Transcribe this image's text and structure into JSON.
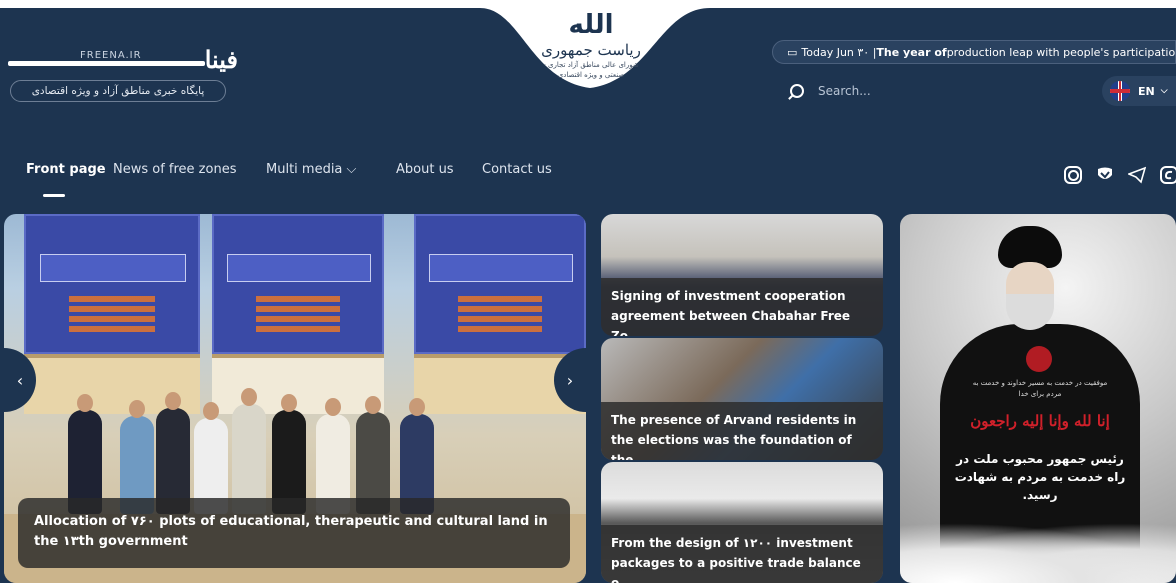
{
  "brand": {
    "name_fa": "فینا",
    "name_en": "FREENA.IR",
    "tagline": "پایگاه خبری مناطق آزاد و ویژه اقتصادی"
  },
  "emblem": {
    "glyph": "الله",
    "title": "ریاست جمهوری",
    "subtitle": "شورای عالی مناطق آزاد تجاری - صنعتی و ویژه اقتصادی"
  },
  "ticker": {
    "date_text": "Today Jun ۳۰ | ",
    "year_prefix": "The year of",
    "year_rest": " production leap with people's participation"
  },
  "search": {
    "placeholder": "Search..."
  },
  "language": {
    "code": "EN"
  },
  "nav": {
    "items": [
      {
        "label": "Front page",
        "active": true
      },
      {
        "label": "News of free zones"
      },
      {
        "label": "Multi media",
        "has_dropdown": true
      },
      {
        "label": "About us"
      },
      {
        "label": "Contact us"
      }
    ]
  },
  "social": [
    "instagram-icon",
    "virasty-icon",
    "telegram-icon",
    "eitaa-icon"
  ],
  "hero": {
    "caption": "Allocation of ۷۶۰ plots of educational, therapeutic and cultural land in the ۱۳th government"
  },
  "news": [
    {
      "caption": "Signing of investment cooperation agreement between Chabahar Free Zo..."
    },
    {
      "caption": "The presence of Arvand residents in the elections was the foundation of the..."
    },
    {
      "caption": "From the design of ۱۲۰۰ investment packages to a positive trade balance o..."
    }
  ],
  "portrait": {
    "small_text": "موفقیت در خدمت به مسیر خداوند و خدمت به مردم برای خدا",
    "red_text": "إنا لله وإنا إليه راجعون",
    "white_text": "رئیس جمهور محبوب ملت در راه خدمت به مردم به شهادت رسید."
  },
  "colors": {
    "header_bg": "#1d3450",
    "caption_bg": "#2d2d2d",
    "active_nav": "#ffffff"
  }
}
